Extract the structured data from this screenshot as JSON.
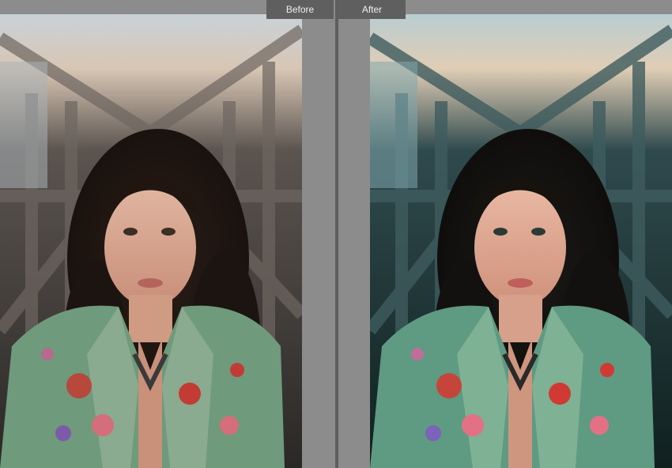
{
  "comparison": {
    "before_label": "Before",
    "after_label": "After"
  },
  "colors": {
    "background": "#8c8c8c",
    "label_bg": "#5f5f5f",
    "label_text": "#f0f0f0",
    "divider": "#5e5e5e"
  }
}
